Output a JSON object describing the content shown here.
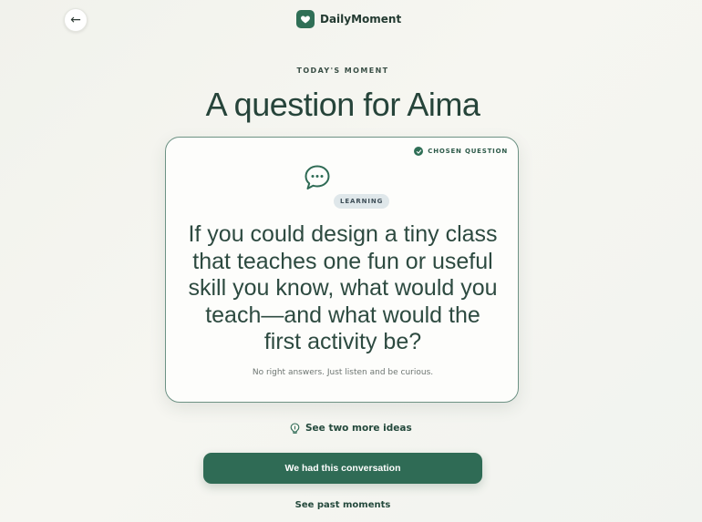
{
  "header": {
    "back_icon": "arrow-left-icon",
    "back_glyph": "←",
    "brand_icon": "heart-icon",
    "brand_name": "DailyMoment"
  },
  "hero": {
    "eyebrow": "TODAY'S MOMENT",
    "title": "A question for Aima"
  },
  "card": {
    "badge_icon": "check-circle-icon",
    "badge_label": "CHOSEN QUESTION",
    "category_icon": "chat-bubble-icon",
    "category": "LEARNING",
    "question": "If you could design a tiny class that teaches one fun or useful skill you know, what would you teach—and what would the first activity be?",
    "hint": "No right answers. Just listen and be curious."
  },
  "actions": {
    "more_ideas_icon": "lightbulb-icon",
    "more_ideas_label": "See two more ideas",
    "primary_label": "We had this conversation",
    "past_label": "See past moments"
  },
  "colors": {
    "accent": "#2f6b55",
    "background": "#f4f4ef",
    "card": "#fdfdfb",
    "tag_background": "#dfe7ea"
  }
}
